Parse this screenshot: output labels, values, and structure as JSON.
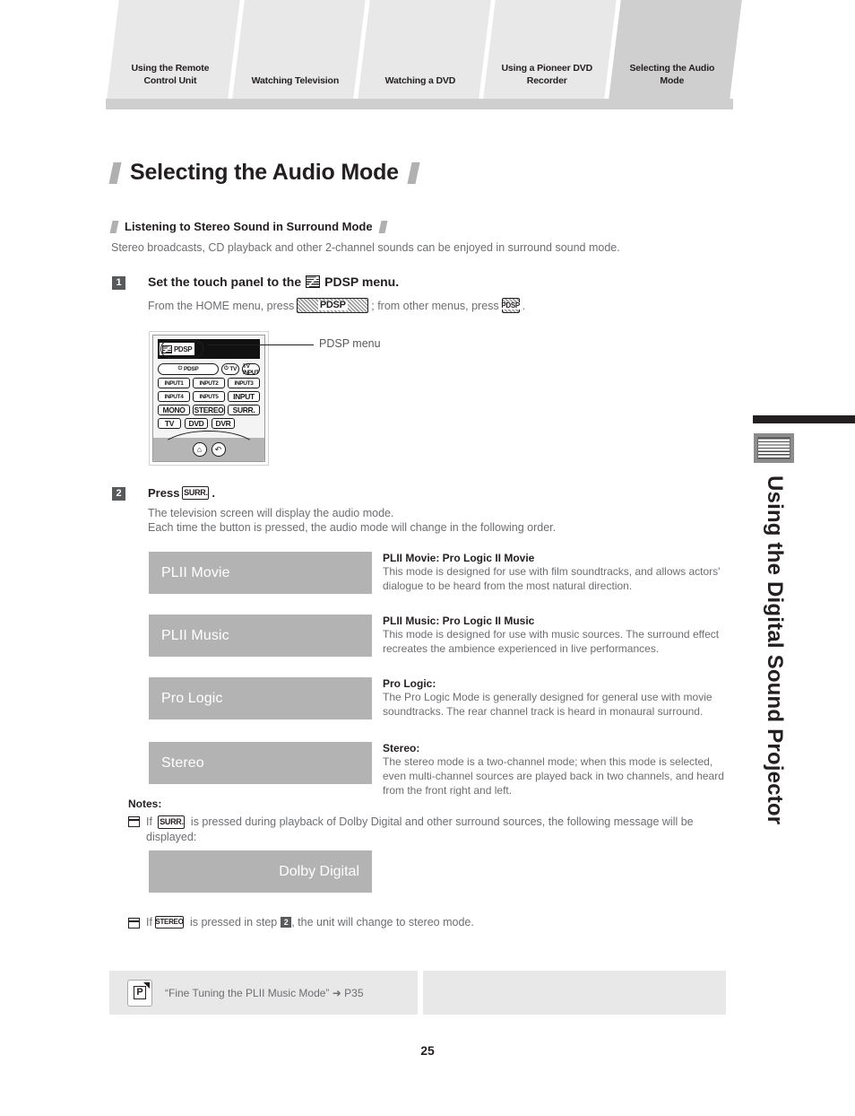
{
  "tabs": [
    {
      "label": "Using the Remote\nControl Unit",
      "active": false
    },
    {
      "label": "Watching Television",
      "active": false
    },
    {
      "label": "Watching a DVD",
      "active": false
    },
    {
      "label": "Using a Pioneer DVD\nRecorder",
      "active": false
    },
    {
      "label": "Selecting the Audio\nMode",
      "active": true
    }
  ],
  "page": {
    "title": "Selecting the Audio Mode",
    "subhead": "Listening to Stereo Sound in Surround Mode",
    "subhead_desc": "Stereo broadcasts, CD playback and other 2-channel sounds can be enjoyed in surround sound mode.",
    "number": "25"
  },
  "step1": {
    "badge": "1",
    "title_before": "Set the touch panel to the",
    "icon": "pdsp-screen-icon",
    "title_after": "PDSP menu.",
    "sub_before": "From the HOME menu, press",
    "key_wide": "PDSP",
    "sub_middle": "; from other menus, press",
    "key_small": "PDSP",
    "sub_after": "."
  },
  "remote": {
    "screen_tab_label": "PDSP",
    "rows": [
      [
        "PDSP",
        "TV",
        "TV INPUT"
      ],
      [
        "INPUT1",
        "INPUT2",
        "INPUT3"
      ],
      [
        "INPUT4",
        "INPUT5",
        "INPUT"
      ],
      [
        "MONO",
        "STEREO",
        "SURR."
      ],
      [
        "TV",
        "DVD",
        "DVR"
      ]
    ],
    "bottom_buttons": [
      "home-icon",
      "return-icon"
    ],
    "callout_label": "PDSP menu"
  },
  "step2": {
    "badge": "2",
    "title_before": "Press",
    "key": "SURR.",
    "title_after": ".",
    "line1": "The television screen will display the audio mode.",
    "line2": "Each time the button is pressed, the audio mode will change in the following order."
  },
  "modes": [
    {
      "box_label": "PLII Movie",
      "desc_title": "PLII Movie: Pro Logic II Movie",
      "desc_body": "This mode is designed for use with film soundtracks, and allows actors' dialogue to be heard from the most natural direction."
    },
    {
      "box_label": "PLII Music",
      "desc_title": "PLII Music: Pro Logic II Music",
      "desc_body": "This mode is designed for use with music sources. The surround effect recreates the ambience experienced in live performances."
    },
    {
      "box_label": "Pro Logic",
      "desc_title": "Pro Logic:",
      "desc_body": "The Pro Logic Mode is generally designed for general use with movie soundtracks. The rear channel track is heard in monaural surround."
    },
    {
      "box_label": "Stereo",
      "desc_title": "Stereo:",
      "desc_body": "The stereo mode is a two-channel mode; when this mode is selected, even multi-channel sources are played back in two channels, and heard from the front right and left."
    }
  ],
  "notes": {
    "label": "Notes:",
    "note1_before": "If",
    "note1_key": "SURR.",
    "note1_after": "is pressed during playback of Dolby Digital and other surround sources, the following message will be displayed:",
    "dolby_box_label": "Dolby Digital",
    "note2_before": "If",
    "note2_key": "STEREO",
    "note2_middle": "is pressed in step",
    "note2_badge": "2",
    "note2_after": ", the unit will change to stereo mode."
  },
  "reference": {
    "icon": "page-reference-icon",
    "icon_letter": "P",
    "text": "“Fine Tuning the PLII Music Mode” ➜ P35"
  },
  "side_tab": {
    "icon": "keypad-grid-icon",
    "title": "Using the Digital Sound Projector"
  },
  "colors": {
    "tab_inactive": "#e8e8e8",
    "tab_active": "#cfcfcf",
    "mode_box": "#b3b3b3",
    "body_text": "#6d6e71",
    "heading_text": "#231f20",
    "badge": "#58595b"
  }
}
